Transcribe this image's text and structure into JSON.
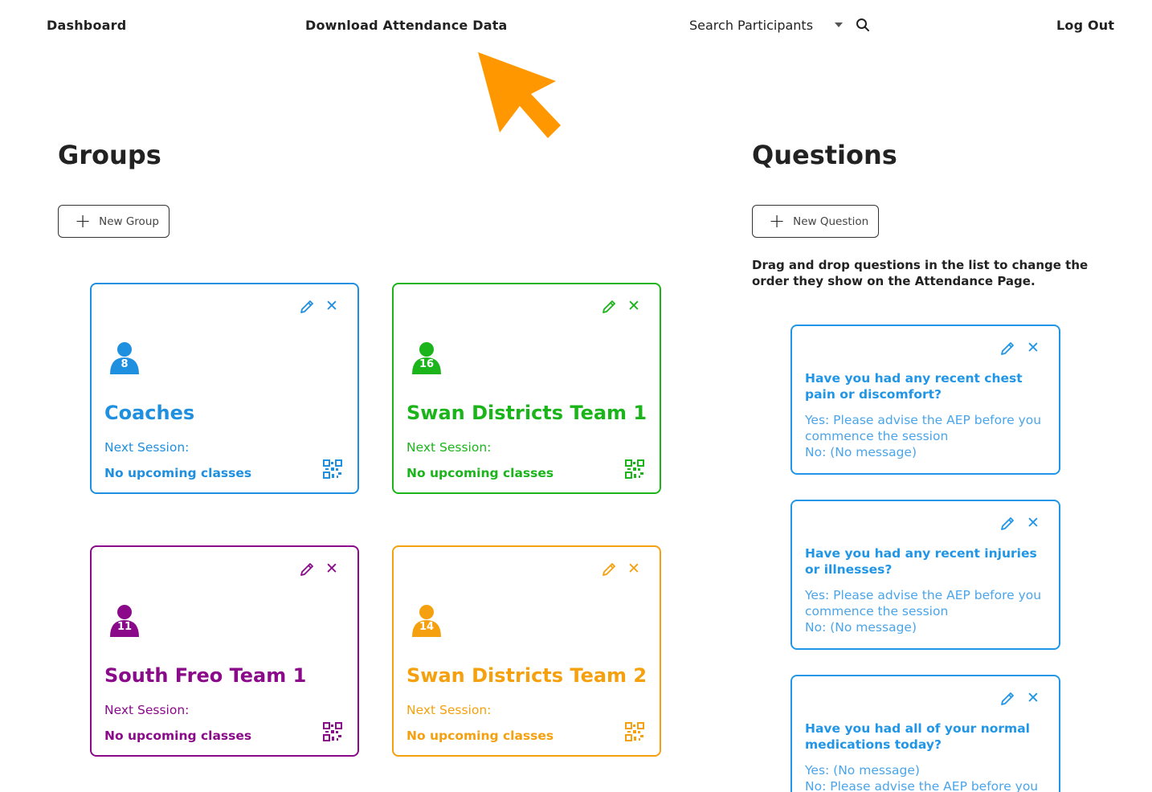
{
  "nav": {
    "dashboard": "Dashboard",
    "download": "Download Attendance Data",
    "search": "Search Participants",
    "logout": "Log Out"
  },
  "groups_section": {
    "title": "Groups",
    "new_button": "New Group",
    "cards": [
      {
        "name": "Coaches",
        "count": "8",
        "next_label": "Next Session:",
        "next_value": "No upcoming classes",
        "color": "#1f8fe0"
      },
      {
        "name": "Swan Districts Team 1",
        "count": "16",
        "next_label": "Next Session:",
        "next_value": "No upcoming classes",
        "color": "#1bb51b"
      },
      {
        "name": "South Freo Team 1",
        "count": "11",
        "next_label": "Next Session:",
        "next_value": "No upcoming classes",
        "color": "#8a0a8a"
      },
      {
        "name": "Swan Districts Team 2",
        "count": "14",
        "next_label": "Next Session:",
        "next_value": "No upcoming classes",
        "color": "#f5a10f"
      }
    ]
  },
  "questions_section": {
    "title": "Questions",
    "new_button": "New Question",
    "hint": "Drag and drop questions in the list to change the order they show on the Attendance Page.",
    "cards": [
      {
        "question": "Have you had any recent chest pain or discomfort?",
        "yes": "Yes: Please advise the AEP before you commence the session",
        "no": "No: (No message)"
      },
      {
        "question": "Have you had any recent injuries or illnesses?",
        "yes": "Yes: Please advise the AEP before you commence the session",
        "no": "No: (No message)"
      },
      {
        "question": "Have you had all of your normal medications today?",
        "yes": "Yes: (No message)",
        "no": "No: Please advise the AEP before you"
      }
    ]
  },
  "colors": {
    "accent": "#2196e6",
    "pointer": "#ff9800"
  }
}
